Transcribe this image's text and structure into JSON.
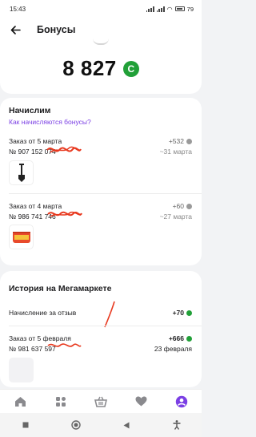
{
  "status_bar": {
    "time": "15:43",
    "battery": "79"
  },
  "header": {
    "title": "Бонусы",
    "back_icon": "arrow-left-icon"
  },
  "balance": {
    "value": "8 827",
    "coin_symbol": "C"
  },
  "accrue": {
    "title": "Начислим",
    "link": "Как начисляются бонусы?",
    "orders": [
      {
        "title": "Заказ от 5 марта",
        "number": "№ 907 152 074",
        "amount": "+532",
        "date": "~31 марта",
        "thumb_icon": "shovel-icon"
      },
      {
        "title": "Заказ от 4 марта",
        "number": "№ 986 741 746",
        "amount": "+60",
        "date": "~27 марта",
        "thumb_icon": "canned-food-icon"
      }
    ]
  },
  "history": {
    "title": "История на Мегамаркете",
    "review": {
      "label": "Начисление за отзыв",
      "amount": "+70"
    },
    "orders": [
      {
        "title": "Заказ от 5 февраля",
        "number": "№ 981 637 597",
        "amount": "+666",
        "date": "23 февраля"
      }
    ]
  },
  "bottom_nav": [
    "home-icon",
    "catalog-icon",
    "cart-icon",
    "favorites-heart-icon",
    "profile-icon"
  ],
  "colors": {
    "accent": "#7b3fe4",
    "bonus_green": "#21a038",
    "scribble_red": "#e8391f"
  }
}
